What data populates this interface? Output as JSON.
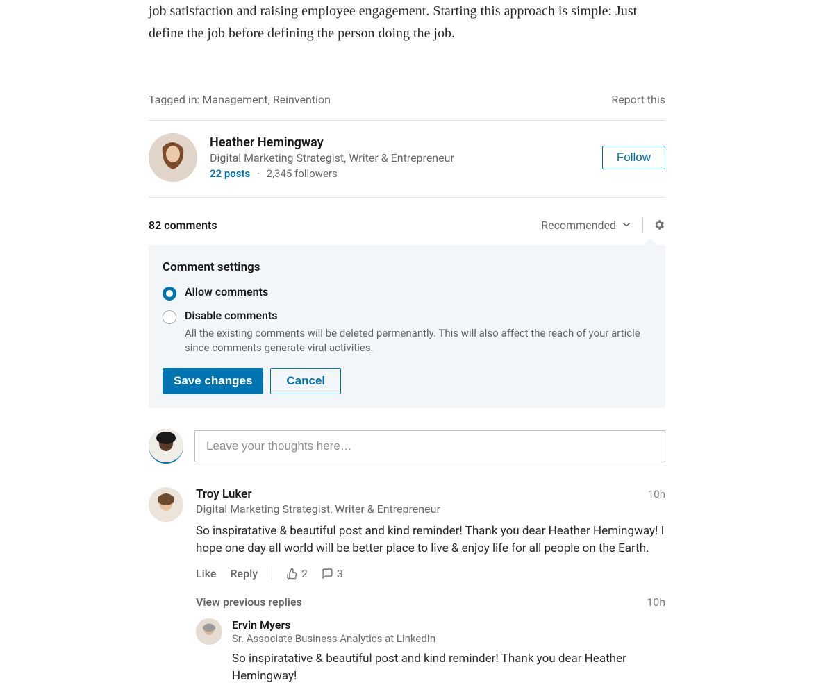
{
  "article": {
    "tail_text": "job satisfaction and raising employee engagement. Starting this approach is simple: Just define the job before defining the person doing the job.",
    "tagged_prefix": "Tagged in: ",
    "tags": [
      "Management",
      "Reinvention"
    ],
    "report": "Report this"
  },
  "author": {
    "name": "Heather Hemingway",
    "headline": "Digital Marketing Strategist, Writer & Entrepreneur",
    "posts": "22 posts",
    "followers": "2,345 followers",
    "follow": "Follow"
  },
  "comments": {
    "count_label": "82 comments",
    "sort_label": "Recommended",
    "compose_placeholder": "Leave your thoughts here…"
  },
  "settings": {
    "title": "Comment settings",
    "allow_label": "Allow comments",
    "disable_label": "Disable comments",
    "disable_desc": "All the existing comments will be deleted permenantly. This will also affect the reach of your article since comments generate viral activities.",
    "save": "Save changes",
    "cancel": "Cancel"
  },
  "c1": {
    "name": "Troy Luker",
    "headline": "Digital Marketing Strategist, Writer & Entrepreneur",
    "time": "10h",
    "text": "So inspiratative & beautiful post and kind reminder! Thank you dear Heather Hemingway! I hope one day all world will be better place to live & enjoy life for all people on the Earth.",
    "like": "Like",
    "reply": "Reply",
    "likes": "2",
    "replies": "3",
    "view_prev": "View previous replies",
    "reply_time": "10h"
  },
  "r1": {
    "name": "Ervin Myers",
    "headline": "Sr. Associate Business Analytics at LinkedIn",
    "text": "So inspiratative & beautiful post and kind reminder! Thank you dear Heather Hemingway!"
  }
}
